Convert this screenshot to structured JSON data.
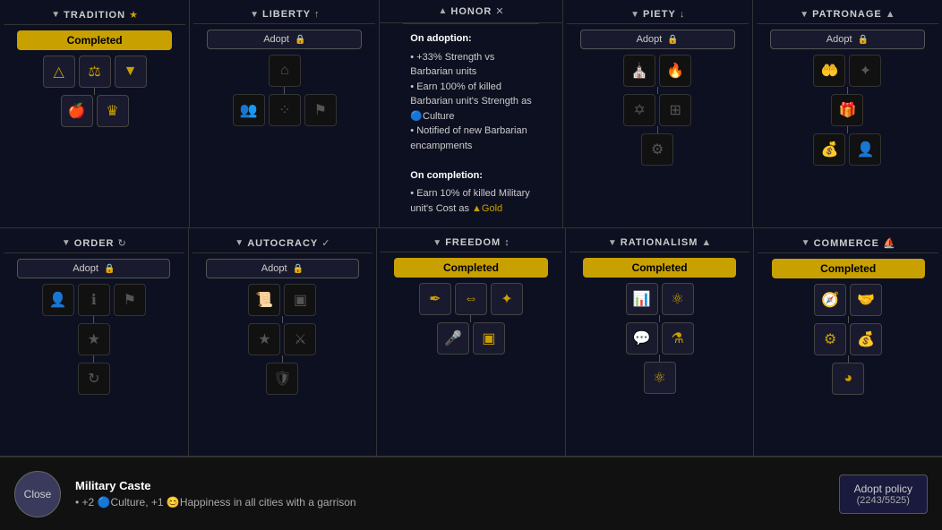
{
  "topRow": [
    {
      "id": "tradition",
      "title": "TRADITION",
      "star": "★",
      "arrow": "▼",
      "status": "completed",
      "icons": [
        [
          "pyramid",
          "hammer",
          "shield"
        ],
        [
          "apple",
          "crown"
        ]
      ]
    },
    {
      "id": "liberty",
      "title": "LIBERTY",
      "star": "↑",
      "arrow": "▼",
      "status": "adopt",
      "icons": [
        [
          "columns"
        ],
        [
          "people",
          "dots",
          "flag"
        ]
      ]
    },
    {
      "id": "honor",
      "title": "HONOR",
      "star": "✕",
      "arrow": "▲",
      "status": "tooltip",
      "tooltip": {
        "adoption_title": "On adoption:",
        "adoption_bullets": [
          "+33% Strength vs Barbarian units",
          "Earn 100% of killed Barbarian unit's Strength as 🔵Culture",
          "Notified of new Barbarian encampments"
        ],
        "completion_title": "On completion:",
        "completion_bullets": [
          "Earn 10% of killed Military unit's Cost as ▲Gold"
        ]
      }
    },
    {
      "id": "piety",
      "title": "PIETY",
      "star": "↓",
      "arrow": "▼",
      "status": "adopt",
      "icons": [
        [
          "temple",
          "fire"
        ],
        [
          "star",
          "grid",
          ""
        ],
        [
          "gear2"
        ]
      ]
    },
    {
      "id": "patronage",
      "title": "PATRONAGE",
      "star": "▲",
      "arrow": "▼",
      "status": "adopt",
      "icons": [
        [
          "hand",
          "sparkle"
        ],
        [
          "gift"
        ],
        [
          "coin",
          "person"
        ]
      ]
    }
  ],
  "bottomRow": [
    {
      "id": "order",
      "title": "ORDER",
      "star": "↻",
      "arrow": "▼",
      "status": "adopt",
      "icons": [
        [
          "person+",
          "info",
          "flag2"
        ],
        [
          "star2"
        ],
        [
          "swirl"
        ]
      ]
    },
    {
      "id": "autocracy",
      "title": "AUTOCRACY",
      "star": "✓",
      "arrow": "▼",
      "status": "adopt",
      "icons": [
        [
          "scroll",
          "badge"
        ],
        [
          "star3",
          "sword"
        ]
      ]
    },
    {
      "id": "freedom",
      "title": "FREEDOM",
      "star": "↕",
      "arrow": "▼",
      "status": "completed",
      "icons": [
        [
          "quill",
          "people2",
          "network"
        ],
        [
          "mic",
          "box"
        ]
      ]
    },
    {
      "id": "rationalism",
      "title": "RATIONALISM",
      "star": "▲",
      "arrow": "▼",
      "status": "completed",
      "icons": [
        [
          "chart",
          "atom2"
        ],
        [
          "chat",
          "flask"
        ],
        [
          "atom"
        ]
      ]
    },
    {
      "id": "commerce",
      "title": "COMMERCE",
      "star": "🚢",
      "arrow": "▼",
      "status": "completed",
      "icons": [
        [
          "compass",
          "handshake"
        ],
        [
          "gear3",
          "coins"
        ],
        [
          "pie"
        ]
      ]
    }
  ],
  "bottom_bar": {
    "close_label": "Close",
    "info_title": "Military Caste",
    "info_desc": "• +2 🔵Culture, +1 😊Happiness in all cities with a garrison",
    "adopt_label": "Adopt policy",
    "adopt_cost": "(2243/5525)"
  },
  "labels": {
    "adopt": "Adopt",
    "completed": "Completed",
    "lock": "🔒"
  }
}
